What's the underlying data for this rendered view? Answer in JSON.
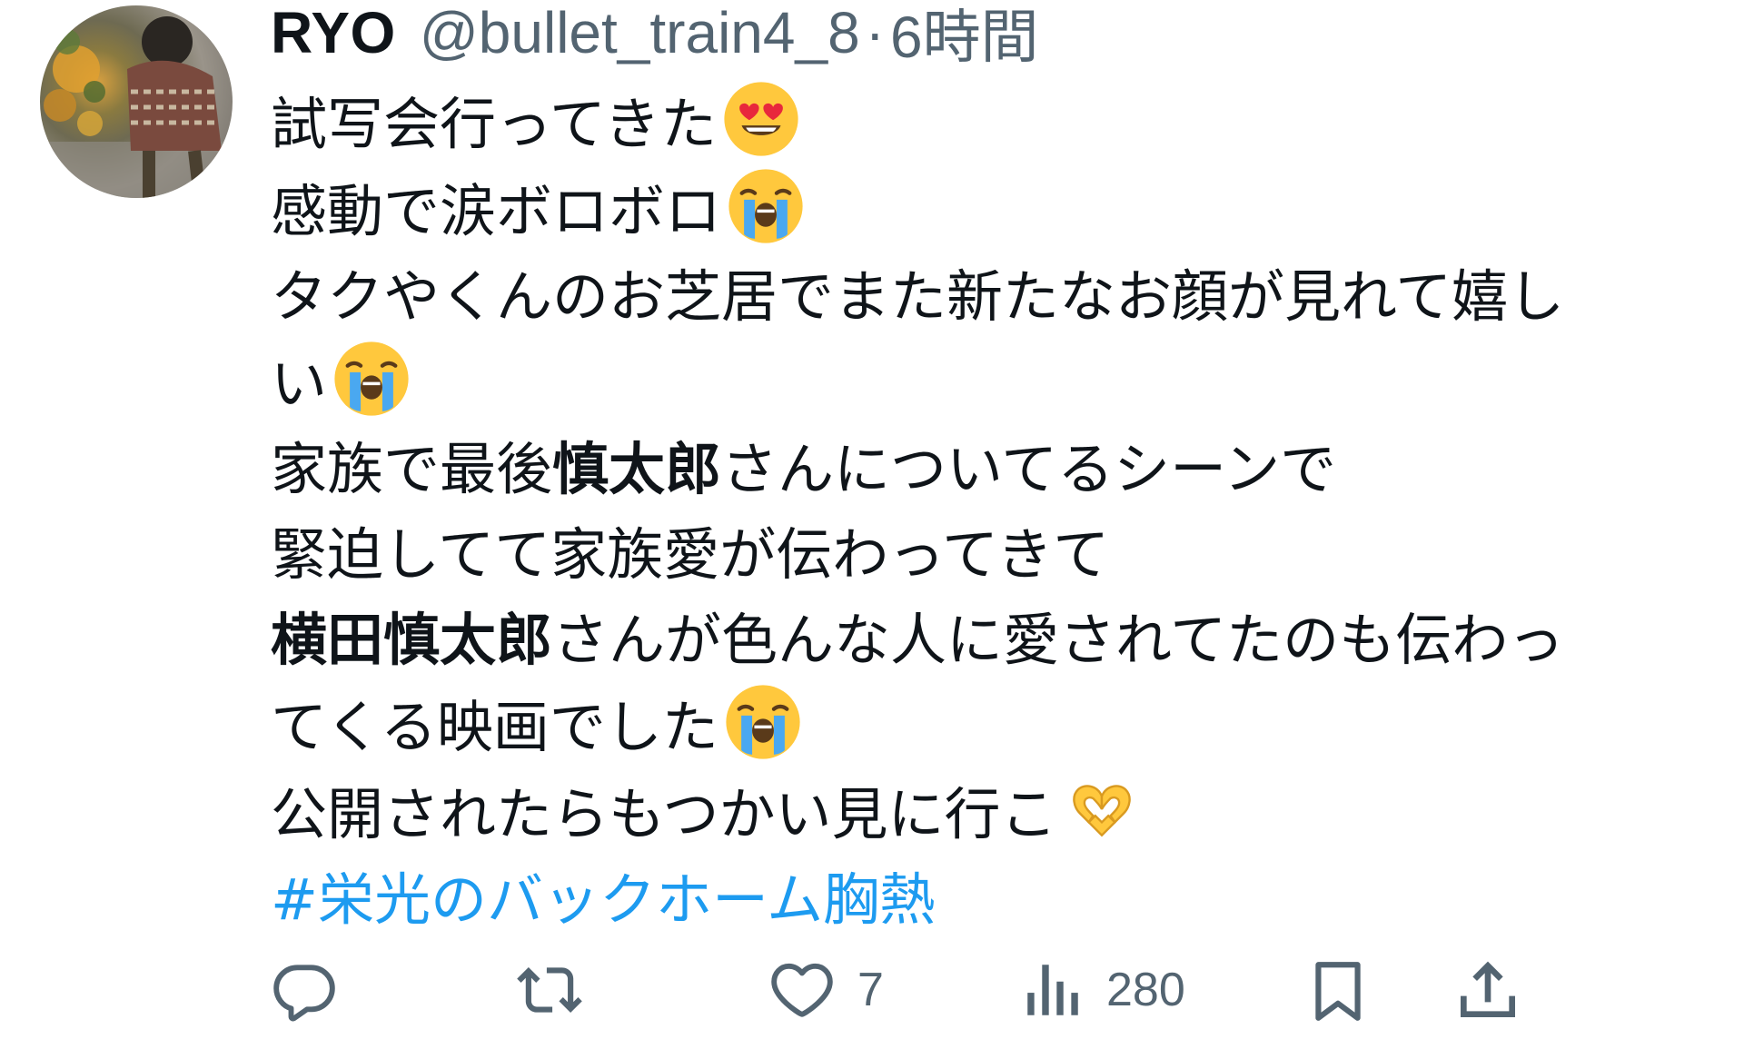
{
  "tweet": {
    "author": {
      "display_name": "RYO",
      "handle": "@bullet_train4_8",
      "separator": "·",
      "timestamp": "6時間"
    },
    "lines": [
      [
        {
          "t": "試写会行ってきた"
        },
        {
          "emoji": "heart-eyes"
        }
      ],
      [
        {
          "t": "感動で涙ボロボロ"
        },
        {
          "emoji": "loudly-crying"
        }
      ],
      [
        {
          "t": "タクやくんのお芝居でまた新たなお顔が見れて嬉し"
        }
      ],
      [
        {
          "t": "い"
        },
        {
          "emoji": "loudly-crying"
        }
      ],
      [
        {
          "t": "家族で最後"
        },
        {
          "b": "慎太郎"
        },
        {
          "t": "さんについてるシーンで"
        }
      ],
      [
        {
          "t": "緊迫してて家族愛が伝わってきて"
        }
      ],
      [
        {
          "b": "横田慎太郎"
        },
        {
          "t": "さんが色んな人に愛されてたのも伝わっ"
        }
      ],
      [
        {
          "t": "てくる映画でした"
        },
        {
          "emoji": "loudly-crying"
        }
      ],
      [
        {
          "t": "公開されたらもつかい見に行こ"
        },
        {
          "emoji": "heart-hands"
        }
      ],
      [
        {
          "tag": "#栄光のバックホーム胸熱"
        }
      ]
    ]
  },
  "actions": {
    "reply": {
      "icon": "reply-icon",
      "count": ""
    },
    "repost": {
      "icon": "repost-icon",
      "count": ""
    },
    "like": {
      "icon": "heart-icon",
      "count": "7"
    },
    "views": {
      "icon": "views-icon",
      "count": "280"
    },
    "bookmark": {
      "icon": "bookmark-icon",
      "count": ""
    },
    "share": {
      "icon": "share-icon",
      "count": ""
    }
  },
  "colors": {
    "text": "#0f1419",
    "secondary": "#536471",
    "link": "#1d9bf0",
    "emoji_yellow": "#ffc83d"
  }
}
